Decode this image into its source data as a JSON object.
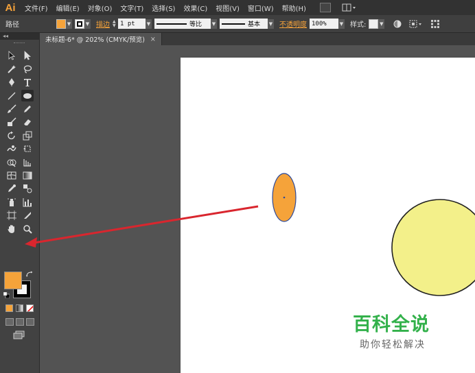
{
  "app": {
    "logo": "Ai",
    "brand_color": "#f7a33a"
  },
  "menu": [
    {
      "label": "文件(F)"
    },
    {
      "label": "编辑(E)"
    },
    {
      "label": "对象(O)"
    },
    {
      "label": "文字(T)"
    },
    {
      "label": "选择(S)"
    },
    {
      "label": "效果(C)"
    },
    {
      "label": "视图(V)"
    },
    {
      "label": "窗口(W)"
    },
    {
      "label": "帮助(H)"
    }
  ],
  "controlbar": {
    "selection_label": "路径",
    "fill_color": "#f5a33a",
    "stroke_link": "描边",
    "stroke_weight": "1 pt",
    "profile_label": "等比",
    "brush_label": "基本",
    "opacity_link": "不透明度",
    "opacity_value": "100%",
    "style_label": "样式:"
  },
  "document": {
    "tab_title": "未标题-6* @ 202% (CMYK/预览)",
    "close_glyph": "×"
  },
  "tools": {
    "fill_color": "#f5a33a",
    "stroke_color": "#000000",
    "panel_collapse_glyph": "◂◂",
    "icons": [
      "selection-tool",
      "direct-selection-tool",
      "magic-wand-tool",
      "lasso-tool",
      "pen-tool",
      "type-tool",
      "line-tool",
      "ellipse-tool",
      "paintbrush-tool",
      "pencil-tool",
      "blob-brush-tool",
      "eraser-tool",
      "rotate-tool",
      "scale-tool",
      "warp-tool",
      "free-transform-tool",
      "shape-builder-tool",
      "perspective-grid-tool",
      "mesh-tool",
      "gradient-tool",
      "eyedropper-tool",
      "blend-tool",
      "symbol-sprayer-tool",
      "column-graph-tool",
      "artboard-tool",
      "slice-tool",
      "hand-tool",
      "zoom-tool"
    ]
  },
  "canvas": {
    "small_ellipse_fill": "#f5a33a",
    "small_ellipse_stroke": "#2d4a9a",
    "circle_fill": "#f3f08a",
    "circle_stroke": "#222222",
    "arrow_color": "#d9262e"
  },
  "watermark": {
    "title": "百科全说",
    "subtitle": "助你轻松解决"
  }
}
